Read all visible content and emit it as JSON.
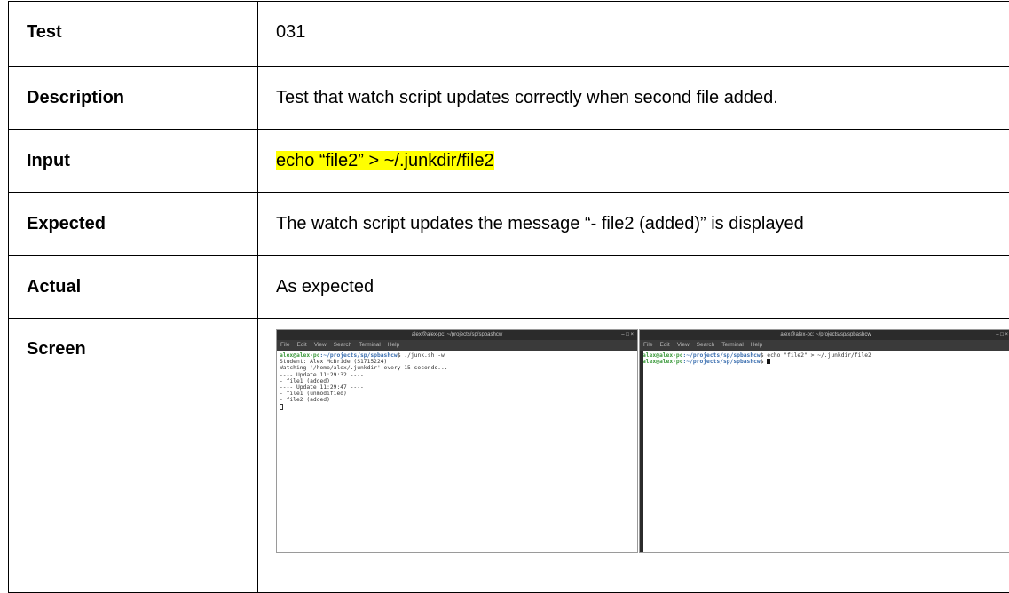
{
  "rows": [
    {
      "label": "Test",
      "value": "031"
    },
    {
      "label": "Description",
      "value": "Test that watch script updates correctly when second file added."
    },
    {
      "label": "Input",
      "value": "echo “file2” > ~/.junkdir/file2",
      "highlighted": true,
      "highlight_color": "#ffff00"
    },
    {
      "label": "Expected",
      "value": "The watch script updates the message “- file2 (added)” is displayed"
    },
    {
      "label": "Actual",
      "value": "As expected"
    },
    {
      "label": "Screen"
    }
  ],
  "screenshot": {
    "left_terminal": {
      "title": "alex@alex-pc: ~/projects/sp/spbashcw",
      "window_buttons": "–  □  ×",
      "menu": [
        "File",
        "Edit",
        "View",
        "Search",
        "Terminal",
        "Help"
      ],
      "prompt_user": "alex@alex-pc",
      "prompt_path": ":~/projects/sp/spbashcw",
      "command": "$ ./junk.sh -w",
      "output": [
        "Student: Alex McBride (S1715224)",
        "Watching '/home/alex/.junkdir' every 15 seconds...",
        "---- Update 11:29:32 ----",
        "- file1 (added)",
        "---- Update 11:29:47 ----",
        "- file1 (unmodified)",
        "- file2 (added)"
      ]
    },
    "right_terminal": {
      "title": "alex@alex-pc: ~/projects/sp/spbashcw",
      "window_buttons": "–  □  ×",
      "menu": [
        "File",
        "Edit",
        "View",
        "Search",
        "Terminal",
        "Help"
      ],
      "prompt_user": "alex@alex-pc",
      "prompt_path": ":~/projects/sp/spbashcw",
      "command": "$ echo \"file2\" > ~/.junkdir/file2",
      "second_prompt_suffix": "$ "
    }
  }
}
